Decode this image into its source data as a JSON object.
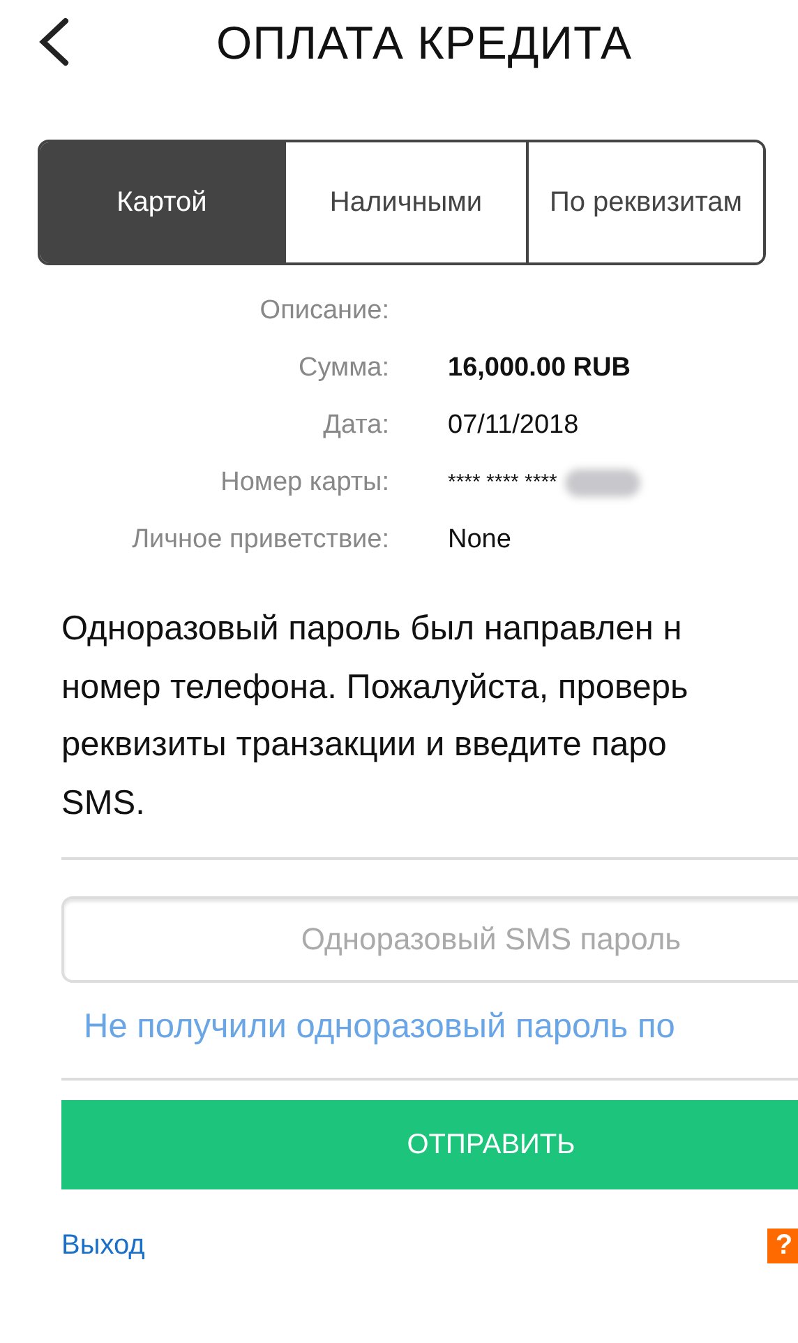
{
  "header": {
    "title": "ОПЛАТА КРЕДИТА"
  },
  "tabs": [
    {
      "label": "Картой",
      "selected": true
    },
    {
      "label": "Наличными",
      "selected": false
    },
    {
      "label": "По реквизитам",
      "selected": false
    }
  ],
  "details": [
    {
      "label": "Описание:"
    },
    {
      "label": "Сумма:",
      "value": "16,000.00 RUB",
      "kind": "bold"
    },
    {
      "label": "Дата:",
      "value": "07/11/2018",
      "kind": "plain"
    },
    {
      "label": "Номер карты:",
      "value": "**** **** ****",
      "kind": "masked"
    },
    {
      "label": "Личное приветствие:",
      "value": "None",
      "kind": "plain"
    }
  ],
  "message_lines": [
    "Одноразовый пароль был направлен н",
    "номер телефона. Пожалуйста, проверь",
    "реквизиты транзакции и введите паро",
    "SMS."
  ],
  "sms_field": {
    "placeholder": "Одноразовый SMS пароль"
  },
  "resend_link": "Не получили одноразовый пароль по",
  "submit_button": "ОТПРАВИТЬ",
  "logout_link": "Выход",
  "help_icon": "?"
}
